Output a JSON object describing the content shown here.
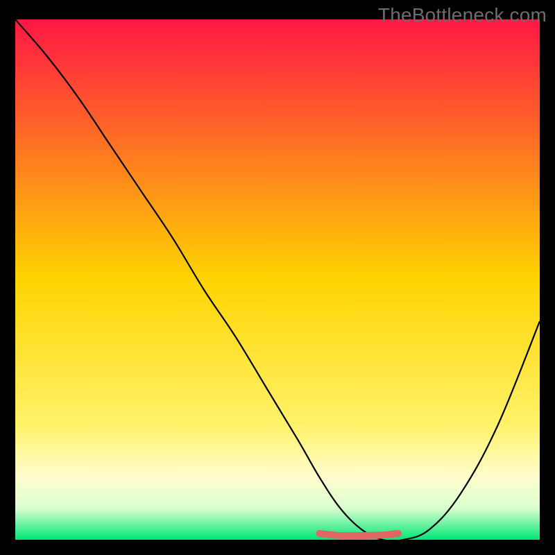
{
  "watermark": "TheBottleneck.com",
  "chart_data": {
    "type": "line",
    "title": "",
    "xlabel": "",
    "ylabel": "",
    "xlim": [
      0,
      100
    ],
    "ylim": [
      0,
      100
    ],
    "legend": false,
    "grid": false,
    "background_gradient": {
      "stops": [
        {
          "offset": 0.0,
          "color": "#ff1744"
        },
        {
          "offset": 0.5,
          "color": "#ffd400"
        },
        {
          "offset": 0.78,
          "color": "#fff26a"
        },
        {
          "offset": 0.88,
          "color": "#fffdcd"
        },
        {
          "offset": 0.94,
          "color": "#d9ffcf"
        },
        {
          "offset": 1.0,
          "color": "#00e676"
        }
      ]
    },
    "series": [
      {
        "name": "bottleneck-curve",
        "x": [
          0,
          6,
          12,
          18,
          24,
          30,
          36,
          42,
          48,
          54,
          58,
          62,
          66,
          70,
          74,
          79,
          85,
          92,
          100
        ],
        "y": [
          100,
          93,
          85,
          76,
          67,
          58,
          48,
          39,
          29,
          19,
          12,
          6,
          2,
          0,
          0,
          2,
          9,
          22,
          42
        ]
      },
      {
        "name": "optimal-band",
        "x": [
          58,
          62,
          66,
          70,
          73
        ],
        "y": [
          1.2,
          0.8,
          0.8,
          0.9,
          1.2
        ]
      }
    ],
    "annotations": []
  }
}
